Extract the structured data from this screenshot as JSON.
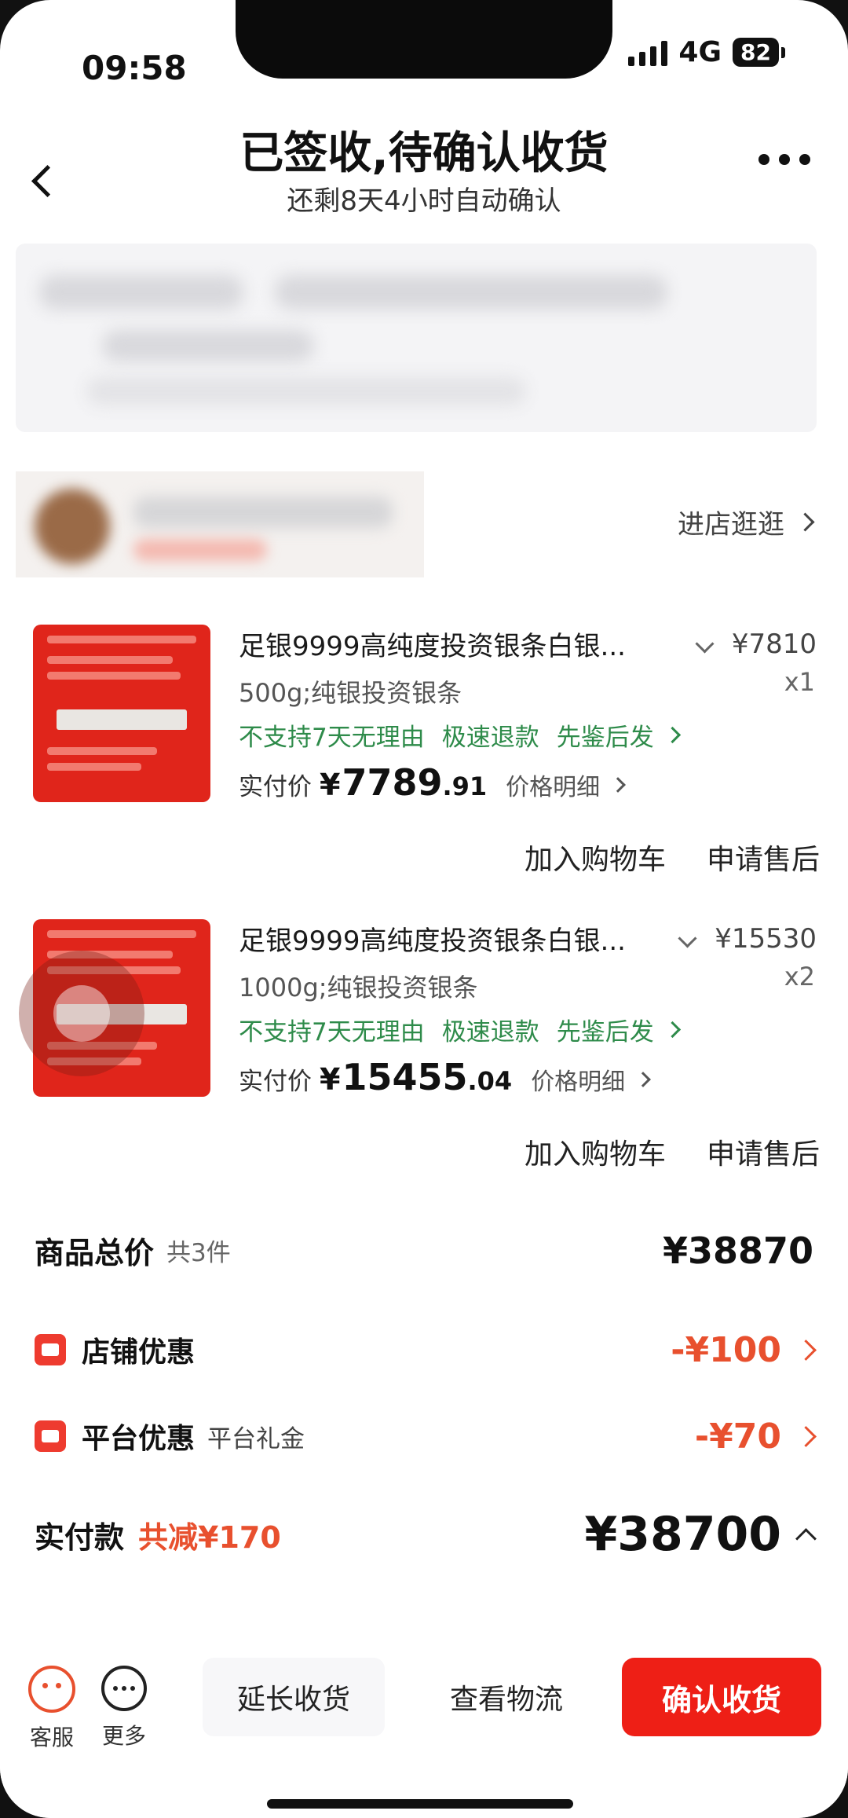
{
  "status_bar": {
    "time": "09:58",
    "network": "4G",
    "battery": "82"
  },
  "header": {
    "title": "已签收,待确认收货",
    "subtitle": "还剩8天4小时自动确认"
  },
  "shop": {
    "visit_label": "进店逛逛"
  },
  "products": [
    {
      "title": "足银9999高纯度投资银条白银...",
      "price": "¥7810",
      "spec": "500g;纯银投资银条",
      "qty": "x1",
      "tags": [
        "不支持7天无理由",
        "极速退款",
        "先鉴后发"
      ],
      "paid_label": "实付价",
      "paid_yen": "¥",
      "paid_int": "7789",
      "paid_dec": ".91",
      "price_detail": "价格明细",
      "add_cart": "加入购物车",
      "after_sale": "申请售后"
    },
    {
      "title": "足银9999高纯度投资银条白银...",
      "price": "¥15530",
      "spec": "1000g;纯银投资银条",
      "qty": "x2",
      "tags": [
        "不支持7天无理由",
        "极速退款",
        "先鉴后发"
      ],
      "paid_label": "实付价",
      "paid_yen": "¥",
      "paid_int": "15455",
      "paid_dec": ".04",
      "price_detail": "价格明细",
      "add_cart": "加入购物车",
      "after_sale": "申请售后"
    }
  ],
  "summary": {
    "goods_total_label": "商品总价",
    "goods_count": "共3件",
    "goods_total": "¥38870",
    "shop_discount_label": "店铺优惠",
    "shop_discount": "-¥100",
    "platform_discount_label": "平台优惠",
    "platform_discount_sub": "平台礼金",
    "platform_discount": "-¥70",
    "paid_label": "实付款",
    "reduced": "共减¥170",
    "paid_total": "¥38700"
  },
  "bottom_bar": {
    "customer_service": "客服",
    "more": "更多",
    "extend": "延长收货",
    "logistics": "查看物流",
    "confirm": "确认收货"
  },
  "colors": {
    "accent": "#ee1f16",
    "discount": "#e8502e",
    "tag_green": "#2e8b4a"
  }
}
